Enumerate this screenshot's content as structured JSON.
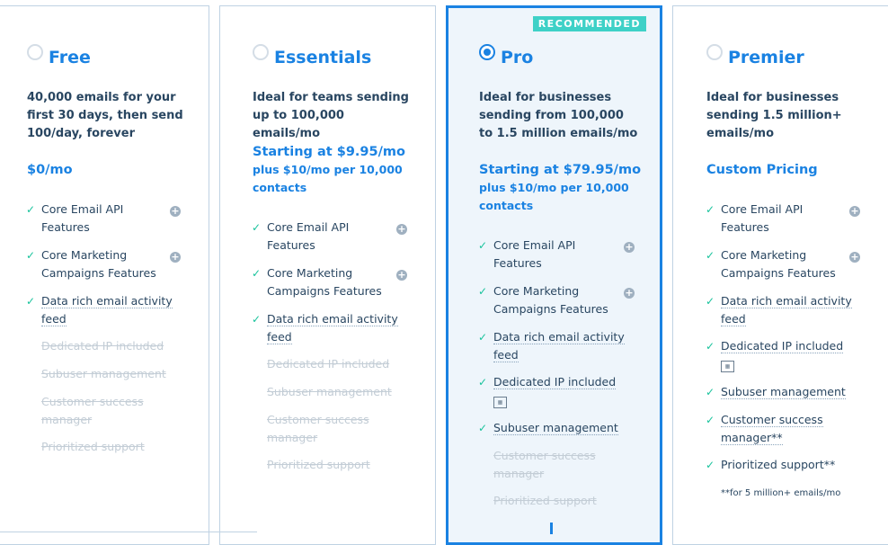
{
  "plans": [
    {
      "name": "Free",
      "desc": "40,000 emails for your first 30 days, then send 100/day, forever",
      "price": "$0/mo",
      "features": [
        "Core Email API Features",
        "Core Marketing Campaigns Features",
        "Data rich email activity feed",
        "Dedicated IP included",
        "Subuser management",
        "Customer success manager",
        "Prioritized support"
      ]
    },
    {
      "name": "Essentials",
      "desc": "Ideal for teams sending up to 100,000 emails/mo",
      "price": "Starting at $9.95/mo",
      "price_sub": "plus $10/mo per 10,000 contacts",
      "features": [
        "Core Email API Features",
        "Core Marketing Campaigns Features",
        "Data rich email activity feed",
        "Dedicated IP included",
        "Subuser management",
        "Customer success manager",
        "Prioritized support"
      ]
    },
    {
      "name": "Pro",
      "badge": "RECOMMENDED",
      "desc": "Ideal for businesses sending from 100,000 to 1.5 million emails/mo",
      "price": "Starting at $79.95/mo",
      "price_sub": "plus $10/mo per 10,000 contacts",
      "features": [
        "Core Email API Features",
        "Core Marketing Campaigns Features",
        "Data rich email activity feed",
        "Dedicated IP included",
        "Subuser management",
        "Customer success manager",
        "Prioritized support"
      ]
    },
    {
      "name": "Premier",
      "desc": "Ideal for businesses sending 1.5 million+ emails/mo",
      "price": "Custom Pricing",
      "features": [
        "Core Email API Features",
        "Core Marketing Campaigns Features",
        "Data rich email activity feed",
        "Dedicated IP included",
        "Subuser management",
        "Customer success manager**",
        "Prioritized support**"
      ],
      "footnote": "**for 5 million+ emails/mo"
    }
  ],
  "selected_plan": "Pro",
  "colors": {
    "accent": "#1a82e2",
    "check": "#19c39c",
    "badge": "#3ed1c7"
  }
}
